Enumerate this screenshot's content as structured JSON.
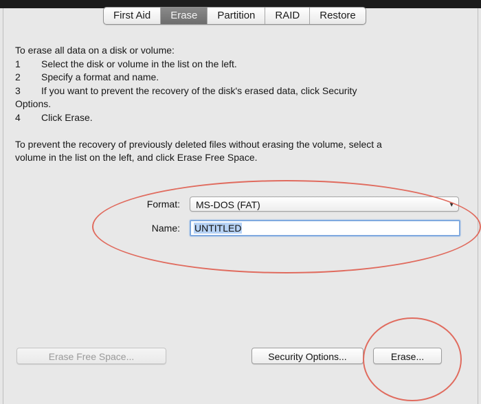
{
  "tabs": [
    {
      "label": "First Aid",
      "active": false
    },
    {
      "label": "Erase",
      "active": true
    },
    {
      "label": "Partition",
      "active": false
    },
    {
      "label": "RAID",
      "active": false
    },
    {
      "label": "Restore",
      "active": false
    }
  ],
  "instructions": {
    "intro": "To erase all data on a disk or volume:",
    "steps": [
      {
        "num": "1",
        "text": "Select the disk or volume in the list on the left."
      },
      {
        "num": "2",
        "text": "Specify a format and name."
      },
      {
        "num": "3",
        "text": "If you want to prevent the recovery of the disk's erased data, click Security",
        "text_cont": "Options."
      },
      {
        "num": "4",
        "text": "Click Erase."
      }
    ],
    "free_space_line1": "To prevent the recovery of previously deleted files without erasing the volume, select a",
    "free_space_line2": "volume in the list on the left, and click Erase Free Space."
  },
  "form": {
    "format_label": "Format:",
    "format_value": "MS-DOS (FAT)",
    "name_label": "Name:",
    "name_value": "UNTITLED"
  },
  "buttons": {
    "erase_free_space": "Erase Free Space...",
    "security_options": "Security Options...",
    "erase": "Erase..."
  },
  "colors": {
    "annotation": "#e06b5e",
    "selection": "#b6d2f5",
    "focus_ring": "#7fa9df"
  }
}
